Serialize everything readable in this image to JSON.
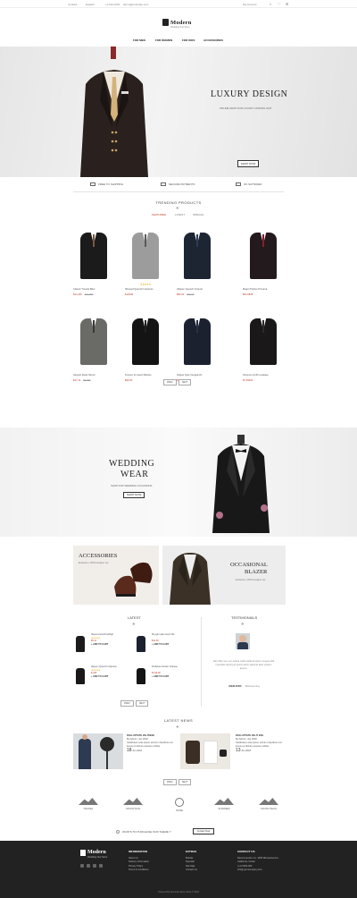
{
  "topbar": {
    "contact_label": "Contact :",
    "flag_label": "English",
    "phone": "+1762-2233",
    "email": "demo@example.com",
    "account_label": "My Account"
  },
  "logo": {
    "name": "Modern",
    "tagline": "Wedding Suit Store"
  },
  "nav": {
    "items": [
      "FOR MEN",
      "FOR WOMEN",
      "FOR KIDS",
      "ACCESSORIES"
    ]
  },
  "hero": {
    "title": "LUXURY DESIGN",
    "subtitle": "ONLINE SHOP FOR LUXURY LOOKING SUIT",
    "button": "SHOP NOW"
  },
  "features": [
    "FREE TO SHIPPING",
    "SECURE PAYMENTS",
    "OK SATISFIED"
  ],
  "trending": {
    "title": "TRENDING PRODUCTS",
    "tabs": [
      "FEATURED",
      "LATEST",
      "SPECIAL"
    ],
    "products": [
      {
        "name": "Classic Tuxedo Blue",
        "price": "$14.445",
        "old_price": "$42.300",
        "rating": 0,
        "jacket_color": "#1b1b1b",
        "tie_color": "#7a5a3a"
      },
      {
        "name": "Ibbused Quench Intopress",
        "price": "$12048",
        "old_price": "",
        "rating": 5,
        "jacket_color": "#9c9c9c",
        "tie_color": "#5a5a5a"
      },
      {
        "name": "Allquen Quench Intopret",
        "price": "$90.00",
        "old_price": "$40.19",
        "rating": 0,
        "jacket_color": "#1d2533",
        "tie_color": "#2f3c5a"
      },
      {
        "name": "Magni Potriue Prixuma",
        "price": "$54.6845",
        "old_price": "",
        "rating": 0,
        "jacket_color": "#231a1d",
        "tie_color": "#8c1c2c"
      },
      {
        "name": "Atopolo Rude Nimior",
        "price": "$17.16",
        "old_price": "$3.080",
        "rating": 0,
        "jacket_color": "#6a6a66",
        "tie_color": "#3a3a3a"
      },
      {
        "name": "Tempro Inc Aevit Dibules",
        "price": "$90.00",
        "old_price": "",
        "rating": 0,
        "jacket_color": "#141414",
        "tie_color": "#202020"
      },
      {
        "name": "Aliquet Quis Vengeinchi",
        "price": "$34.502",
        "old_price": "",
        "rating": 0,
        "jacket_color": "#1c2130",
        "tie_color": "#2a2f44"
      },
      {
        "name": "Inforpus Cunffn Loelque",
        "price": "$7.33000",
        "old_price": "",
        "rating": 0,
        "jacket_color": "#1a1818",
        "tie_color": "#2b2b2b"
      }
    ],
    "pager": [
      "PREV",
      "NEXT"
    ]
  },
  "wedding": {
    "title_line1": "WEDDING",
    "title_line2": "WEAR",
    "subtitle": "SHOP FOR WEDDING OCCASIONS",
    "button": "SHOP NOW"
  },
  "banners": {
    "left_title": "ACCESSORIES",
    "left_sub": "Exclusive | 100% designer set",
    "right_title_line1": "OCCASIONAL",
    "right_title_line2": "BLAZER",
    "right_sub": "Exclusive | 100% designer set"
  },
  "latest": {
    "title": "LATEST",
    "items": [
      {
        "name": "Aliquet Auctofit Auflrgh",
        "price": "$5.4x",
        "rating": 5,
        "add": "+ ADD TO CART",
        "jacket_color": "#1b1b1b"
      },
      {
        "name": "Slu-gle Lake Inosin Ifkt",
        "price": "$12.90",
        "rating": 0,
        "add": "+ ADD TO CART",
        "jacket_color": "#1c2130"
      },
      {
        "name": "Allquen Quench Intopress",
        "price": "$,330",
        "rating": 5,
        "add": "+ ADD TO CART",
        "jacket_color": "#1a1818"
      },
      {
        "name": "Drellituse Sunfen Colpuse",
        "price": "$1,99.00",
        "rating": 0,
        "add": "+ ADD TO CART",
        "jacket_color": "#141414"
      }
    ],
    "pager": [
      "PREV",
      "NEXT"
    ]
  },
  "testimonials": {
    "title": "TESTIMONIALS",
    "text": "Nam liber tem cum soluta nobis eleifend option congue nihil imperdiet doming id quod mazim placerat facer possim assum.",
    "author": "JOHN DUFF",
    "role": "Business Guy"
  },
  "news": {
    "title": "LATEST NEWS",
    "posts": [
      {
        "title": "DOLLUPTATE VELITIESS",
        "meta": "By Admin | Jun 2018",
        "excerpt": "Vestibulum ante ipsum primis in faucibus orci luctus et ultrices posuere cubilia.",
        "day": "18",
        "month": "Jun 2018"
      },
      {
        "title": "DOLLUPTATE VELIT ESS",
        "meta": "By Admin | Jun 2018",
        "excerpt": "Vestibulum ante ipsum primis in faucibus orci luctus et ultrices posuere cubilia.",
        "day": "13",
        "month": "Jun 2018"
      }
    ],
    "pager": [
      "PREV",
      "NEXT"
    ]
  },
  "brands": [
    "TRAVEL",
    "MOUNTAIN",
    "WINE",
    "SUMMER",
    "SNOW PEAK"
  ],
  "newsletter": {
    "text": "WANTS TO PURCHASE OUR THEME ?",
    "button": "Contact Now"
  },
  "footer": {
    "logo": "Modern",
    "tagline": "Wedding Suit Store",
    "info_title": "INFORMATION",
    "info_links": [
      "About Us",
      "Delivery Information",
      "Privacy Policy",
      "Terms & Conditions"
    ],
    "extras_title": "EXTRAS",
    "extras_links": [
      "Brands",
      "Specials",
      "Site Map",
      "Contact Us"
    ],
    "contact_title": "CONTACT US",
    "contact_lines": [
      "Recommends, Inc. 1455 Minnesota Ave. California, Ocean",
      "(+1) 0000-000",
      "info@yourcompany.com"
    ],
    "copyright": "Powered By OpenCart Demo Store © 2024"
  },
  "colors": {
    "accent": "#c0392b",
    "star": "#e8b32a",
    "dark": "#222222"
  }
}
